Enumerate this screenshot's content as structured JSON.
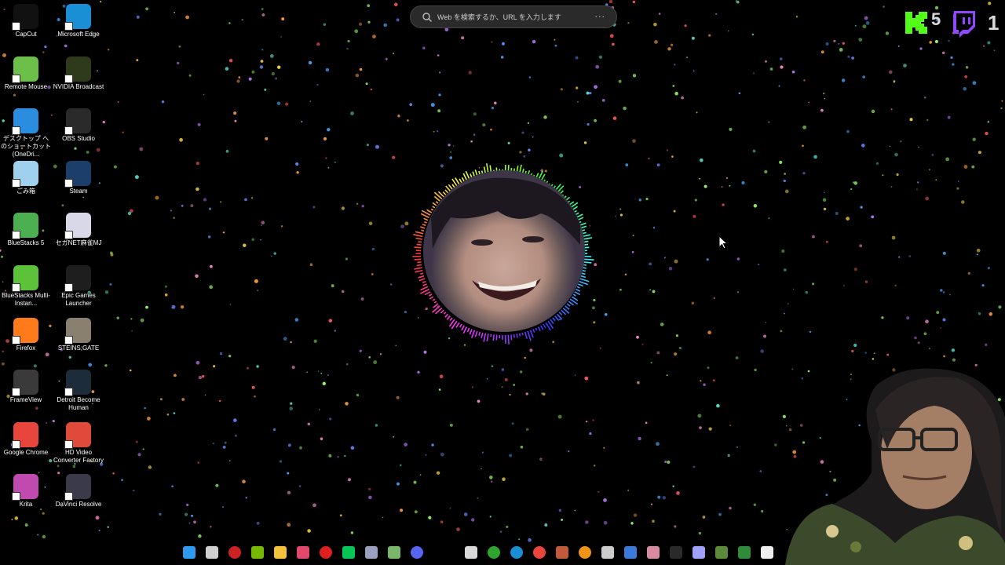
{
  "desktop": {
    "icons": [
      {
        "label": "CapCut",
        "icon": "capcut-icon",
        "color": "#111111"
      },
      {
        "label": "Microsoft Edge",
        "icon": "edge-icon",
        "color": "#1a8fd6"
      },
      {
        "label": "Remote Mouse",
        "icon": "remote-mouse-icon",
        "color": "#6cc04a"
      },
      {
        "label": "NVIDIA Broadcast",
        "icon": "nvidia-broadcast-icon",
        "color": "#2e3a1a"
      },
      {
        "label": "デスクトップ へのショートカット (OneDri...",
        "icon": "onedrive-icon",
        "color": "#2b8de0"
      },
      {
        "label": "OBS Studio",
        "icon": "obs-icon",
        "color": "#2a2a2a"
      },
      {
        "label": "ごみ箱",
        "icon": "recycle-bin-icon",
        "color": "#9fd0ee"
      },
      {
        "label": "Steam",
        "icon": "steam-icon",
        "color": "#1b3f6a"
      },
      {
        "label": "BlueStacks 5",
        "icon": "bluestacks-icon",
        "color": "#4caf50"
      },
      {
        "label": "セガNET麻雀MJ",
        "icon": "mj-icon",
        "color": "#d8d8e8"
      },
      {
        "label": "BlueStacks Multi-Instan...",
        "icon": "bluestacks-multi-icon",
        "color": "#5cc23a"
      },
      {
        "label": "Epic Games Launcher",
        "icon": "epic-games-icon",
        "color": "#1e1e1e"
      },
      {
        "label": "Firefox",
        "icon": "firefox-icon",
        "color": "#ff7a1a"
      },
      {
        "label": "STEINS;GATE",
        "icon": "steins-gate-icon",
        "color": "#8a8070"
      },
      {
        "label": "FrameView",
        "icon": "frameview-icon",
        "color": "#3a3a3a"
      },
      {
        "label": "Detroit Become Human",
        "icon": "detroit-icon",
        "color": "#1c2c3a"
      },
      {
        "label": "Google Chrome",
        "icon": "chrome-icon",
        "color": "#e8453c"
      },
      {
        "label": "HD Video Converter Factory",
        "icon": "hd-video-converter-icon",
        "color": "#e04a3a"
      },
      {
        "label": "Krita",
        "icon": "krita-icon",
        "color": "#c04ab0"
      },
      {
        "label": "DaVinci Resolve",
        "icon": "davinci-icon",
        "color": "#3a3a4a"
      }
    ]
  },
  "search": {
    "placeholder": "Web を検索するか、URL を入力します",
    "more": "···"
  },
  "overlay": {
    "kick_count": "5",
    "twitch_count": "1"
  },
  "taskbar": {
    "items": [
      {
        "icon": "windows-start-icon",
        "color": "#2f9bf0"
      },
      {
        "icon": "task-view-icon",
        "color": "#d0d0d0"
      },
      {
        "icon": "chrome-profile-icon",
        "color": "#cc2222"
      },
      {
        "icon": "nvidia-icon",
        "color": "#76b900"
      },
      {
        "icon": "file-explorer-icon",
        "color": "#f3c13a"
      },
      {
        "icon": "lips-app-icon",
        "color": "#e0486c"
      },
      {
        "icon": "record-icon",
        "color": "#e02020"
      },
      {
        "icon": "line-icon",
        "color": "#06c755"
      },
      {
        "icon": "app-link-icon",
        "color": "#9aa0c0"
      },
      {
        "icon": "vim-icon",
        "color": "#79b86a"
      },
      {
        "icon": "discord-icon",
        "color": "#5865f2"
      },
      {
        "icon": "store-icon",
        "color": "#d8d8d8"
      },
      {
        "icon": "xbox-icon",
        "color": "#2fa52f"
      },
      {
        "icon": "edge-taskbar-icon",
        "color": "#1a8fd6"
      },
      {
        "icon": "chrome-taskbar-icon",
        "color": "#e8453c"
      },
      {
        "icon": "game-app-icon",
        "color": "#c05a3a"
      },
      {
        "icon": "bitcoin-icon",
        "color": "#f09418"
      },
      {
        "icon": "back-icon",
        "color": "#cccccc"
      },
      {
        "icon": "calendar-icon",
        "color": "#3a7ad8"
      },
      {
        "icon": "photos-icon",
        "color": "#d88aa0"
      },
      {
        "icon": "cloud-icon",
        "color": "#2a2a2a"
      },
      {
        "icon": "device-icon",
        "color": "#a0a0ff"
      },
      {
        "icon": "minecraft-icon",
        "color": "#5a8a3a"
      },
      {
        "icon": "spreadsheet-icon",
        "color": "#2f8a3a"
      },
      {
        "icon": "capcut-taskbar-icon",
        "color": "#eeeeee"
      }
    ]
  },
  "colors": {
    "kick": "#53fc18",
    "twitch": "#9147ff",
    "accent": "#2f9bf0"
  }
}
